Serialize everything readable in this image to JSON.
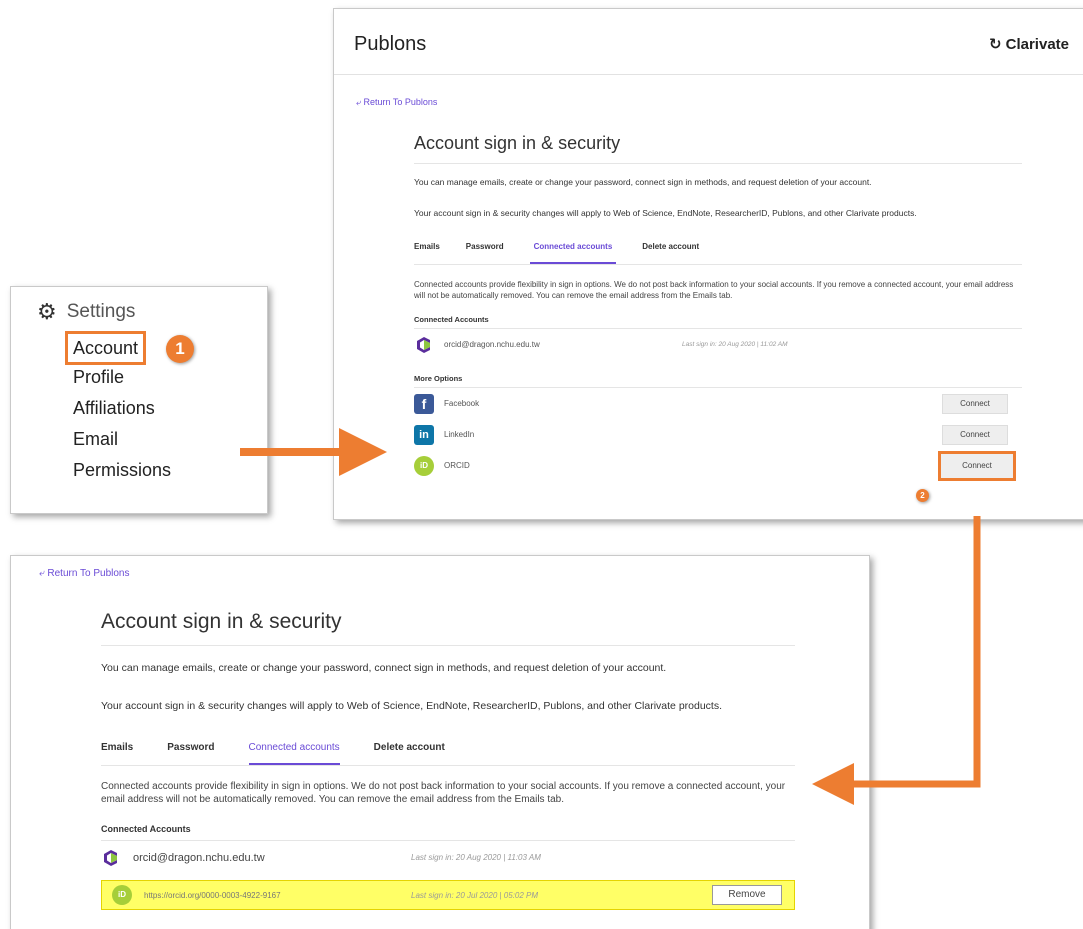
{
  "settings": {
    "title": "Settings",
    "items": [
      "Account",
      "Profile",
      "Affiliations",
      "Email",
      "Permissions"
    ],
    "step": "1"
  },
  "top": {
    "brand": "Publons",
    "logo": "Clarivate",
    "return_link": "Return To Publons",
    "heading": "Account sign in & security",
    "para1": "You can manage emails, create or change your password, connect sign in methods, and request deletion of your account.",
    "para2": "Your account sign in & security changes will apply to Web of Science, EndNote, ResearcherID, Publons, and other Clarivate products.",
    "tabs": [
      "Emails",
      "Password",
      "Connected accounts",
      "Delete account"
    ],
    "description": "Connected accounts provide flexibility in sign in options. We do not post back information to your social accounts. If you remove a connected account, your email address will not be automatically removed. You can remove the email address from the Emails tab.",
    "connected_heading": "Connected Accounts",
    "connected": [
      {
        "label": "orcid@dragon.nchu.edu.tw",
        "meta": "Last sign in: 20 Aug 2020 | 11:02 AM"
      }
    ],
    "more_heading": "More Options",
    "options": [
      {
        "label": "Facebook",
        "button": "Connect"
      },
      {
        "label": "LinkedIn",
        "button": "Connect"
      },
      {
        "label": "ORCID",
        "button": "Connect"
      }
    ],
    "step": "2"
  },
  "bottom": {
    "return_link": "Return To Publons",
    "heading": "Account sign in & security",
    "para1": "You can manage emails, create or change your password, connect sign in methods, and request deletion of your account.",
    "para2": "Your account sign in & security changes will apply to Web of Science, EndNote, ResearcherID, Publons, and other Clarivate products.",
    "tabs": [
      "Emails",
      "Password",
      "Connected accounts",
      "Delete account"
    ],
    "description": "Connected accounts provide flexibility in sign in options. We do not post back information to your social accounts. If you remove a connected account, your email address will not be automatically removed. You can remove the email address from the Emails tab.",
    "connected_heading": "Connected Accounts",
    "connected": [
      {
        "label": "orcid@dragon.nchu.edu.tw",
        "meta": "Last sign in: 20 Aug 2020 | 11:03 AM"
      },
      {
        "label": "https://orcid.org/0000-0003-4922-9167",
        "meta": "Last sign in: 20 Jul 2020 | 05:02 PM",
        "button": "Remove"
      }
    ]
  },
  "colors": {
    "accent": "#ed7d31",
    "link": "#6a4bd6",
    "highlight": "#ffff66",
    "facebook": "#3b5998",
    "linkedin": "#0e76a8",
    "orcid": "#a6ce39"
  },
  "icons": [
    "gear-icon",
    "return-arrow-icon",
    "clarivate-logo-icon",
    "clarivate-account-icon",
    "facebook-icon",
    "linkedin-icon",
    "orcid-icon"
  ]
}
